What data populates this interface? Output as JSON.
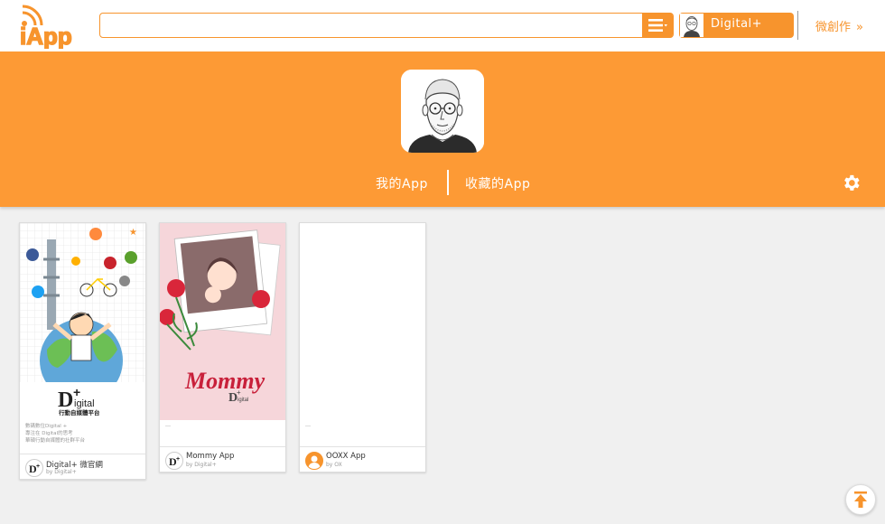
{
  "header": {
    "logo_text": "iApp",
    "search": {
      "value": "",
      "placeholder": ""
    },
    "user": {
      "name": "Digital+"
    },
    "brand_link": {
      "label": "微創作",
      "arrow": "»"
    }
  },
  "profile": {
    "tabs": [
      {
        "label": "我的App"
      },
      {
        "label": "收藏的App"
      }
    ]
  },
  "apps": [
    {
      "poster_brand": "D+ igital",
      "poster_caption": "行動自媒體平台",
      "desc_lines": [
        "數碼數位Digital +",
        "專注在 Digital的思考",
        "華碩行動自媒體的社群平台"
      ],
      "name": "Digital+ 微官網",
      "by": "by  Digital+"
    },
    {
      "poster_title": "Mommy",
      "poster_brand": "D+ igital",
      "desc": "---",
      "name": "Mommy App",
      "by": "by  Digital+"
    },
    {
      "desc": "---",
      "name": "OOXX App",
      "by": "by  OX"
    }
  ],
  "colors": {
    "accent": "#fd9a35",
    "accent_dark": "#f7942d",
    "background": "#f0f0f0"
  }
}
